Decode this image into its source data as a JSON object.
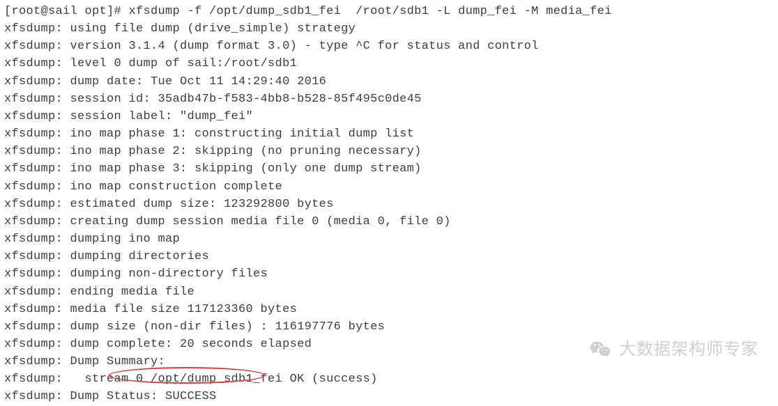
{
  "terminal": {
    "prompt": "[root@sail opt]# ",
    "command": "xfsdump -f /opt/dump_sdb1_fei  /root/sdb1 -L dump_fei -M media_fei",
    "output": [
      "xfsdump: using file dump (drive_simple) strategy",
      "xfsdump: version 3.1.4 (dump format 3.0) - type ^C for status and control",
      "xfsdump: level 0 dump of sail:/root/sdb1",
      "xfsdump: dump date: Tue Oct 11 14:29:40 2016",
      "xfsdump: session id: 35adb47b-f583-4bb8-b528-85f495c0de45",
      "xfsdump: session label: \"dump_fei\"",
      "xfsdump: ino map phase 1: constructing initial dump list",
      "xfsdump: ino map phase 2: skipping (no pruning necessary)",
      "xfsdump: ino map phase 3: skipping (only one dump stream)",
      "xfsdump: ino map construction complete",
      "xfsdump: estimated dump size: 123292800 bytes",
      "xfsdump: creating dump session media file 0 (media 0, file 0)",
      "xfsdump: dumping ino map",
      "xfsdump: dumping directories",
      "xfsdump: dumping non-directory files",
      "xfsdump: ending media file",
      "xfsdump: media file size 117123360 bytes",
      "xfsdump: dump size (non-dir files) : 116197776 bytes",
      "xfsdump: dump complete: 20 seconds elapsed",
      "xfsdump: Dump Summary:",
      "xfsdump:   stream 0 /opt/dump_sdb1_fei OK (success)",
      "xfsdump: Dump Status: SUCCESS"
    ]
  },
  "watermark": {
    "text": "大数据架构师专家"
  }
}
